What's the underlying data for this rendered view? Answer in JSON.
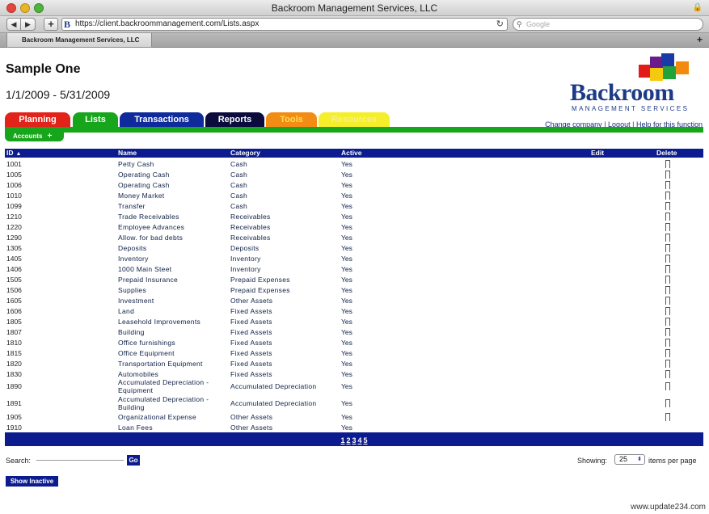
{
  "window": {
    "title": "Backroom Management Services, LLC"
  },
  "browser": {
    "url": "https://client.backroommanagement.com/Lists.aspx",
    "favicon_letter": "B",
    "search_placeholder": "Google",
    "tab_label": "Backroom Management Services, LLC",
    "add_label": "+",
    "new_tab_label": "+",
    "back_label": "◀",
    "forward_label": "▶",
    "reload_label": "↻",
    "lock_label": "🔒",
    "search_glass_label": "⚲"
  },
  "page": {
    "title": "Sample One",
    "date_range": "1/1/2009 - 5/31/2009"
  },
  "logo": {
    "word": "Backroom",
    "subtitle": "MANAGEMENT SERVICES",
    "colors": {
      "red": "#e11b17",
      "orange": "#f28a0d",
      "yellow": "#f5c90e",
      "purple": "#6b1b8a",
      "blue": "#1b3aa6",
      "green": "#22a33a",
      "navy": "#1c3a86"
    }
  },
  "top_links": {
    "change_company": "Change company",
    "logout": "Logout",
    "help": "Help for this function",
    "separator": "|"
  },
  "main_tabs": [
    {
      "label": "Planning",
      "color": "#e2231a"
    },
    {
      "label": "Lists",
      "color": "#16a51b"
    },
    {
      "label": "Transactions",
      "color": "#0e2a9b"
    },
    {
      "label": "Reports",
      "color": "#0b0b3d"
    },
    {
      "label": "Tools",
      "color": "#f28c14"
    },
    {
      "label": "Resources",
      "color": "#f5ee2a"
    }
  ],
  "sub_tab": {
    "label": "Accounts",
    "add": "+"
  },
  "table": {
    "headers": {
      "id": "ID",
      "name": "Name",
      "category": "Category",
      "active": "Active",
      "edit": "Edit",
      "delete": "Delete"
    },
    "sort_indicator": "▲",
    "rows": [
      {
        "id": "1001",
        "name": "Petty Cash",
        "category": "Cash",
        "active": "Yes"
      },
      {
        "id": "1005",
        "name": "Operating Cash",
        "category": "Cash",
        "active": "Yes"
      },
      {
        "id": "1006",
        "name": "Operating Cash",
        "category": "Cash",
        "active": "Yes"
      },
      {
        "id": "1010",
        "name": "Money Market",
        "category": "Cash",
        "active": "Yes"
      },
      {
        "id": "1099",
        "name": "Transfer",
        "category": "Cash",
        "active": "Yes"
      },
      {
        "id": "1210",
        "name": "Trade Receivables",
        "category": "Receivables",
        "active": "Yes"
      },
      {
        "id": "1220",
        "name": "Employee Advances",
        "category": "Receivables",
        "active": "Yes"
      },
      {
        "id": "1290",
        "name": "Allow. for bad debts",
        "category": "Receivables",
        "active": "Yes"
      },
      {
        "id": "1305",
        "name": "Deposits",
        "category": "Deposits",
        "active": "Yes"
      },
      {
        "id": "1405",
        "name": "Inventory",
        "category": "Inventory",
        "active": "Yes"
      },
      {
        "id": "1406",
        "name": "1000 Main Steet",
        "category": "Inventory",
        "active": "Yes"
      },
      {
        "id": "1505",
        "name": "Prepaid Insurance",
        "category": "Prepaid Expenses",
        "active": "Yes"
      },
      {
        "id": "1506",
        "name": "Supplies",
        "category": "Prepaid Expenses",
        "active": "Yes"
      },
      {
        "id": "1605",
        "name": "Investment",
        "category": "Other Assets",
        "active": "Yes"
      },
      {
        "id": "1606",
        "name": "Land",
        "category": "Fixed Assets",
        "active": "Yes"
      },
      {
        "id": "1805",
        "name": "Leasehold Improvements",
        "category": "Fixed Assets",
        "active": "Yes"
      },
      {
        "id": "1807",
        "name": "Building",
        "category": "Fixed Assets",
        "active": "Yes"
      },
      {
        "id": "1810",
        "name": "Office furnishings",
        "category": "Fixed Assets",
        "active": "Yes"
      },
      {
        "id": "1815",
        "name": "Office Equipment",
        "category": "Fixed Assets",
        "active": "Yes"
      },
      {
        "id": "1820",
        "name": "Transportation Equipment",
        "category": "Fixed Assets",
        "active": "Yes"
      },
      {
        "id": "1830",
        "name": "Automobiles",
        "category": "Fixed Assets",
        "active": "Yes"
      },
      {
        "id": "1890",
        "name": "Accumulated Depreciation - Equipment",
        "category": "Accumulated Depreciation",
        "active": "Yes"
      },
      {
        "id": "1891",
        "name": "Accumulated Depreciation - Building",
        "category": "Accumulated Depreciation",
        "active": "Yes"
      },
      {
        "id": "1905",
        "name": "Organizational Expense",
        "category": "Other Assets",
        "active": "Yes"
      },
      {
        "id": "1910",
        "name": "Loan Fees",
        "category": "Other Assets",
        "active": "Yes"
      }
    ]
  },
  "pagination": {
    "pages": [
      "1",
      "2",
      "3",
      "4",
      "5"
    ]
  },
  "search": {
    "label": "Search:",
    "value": "",
    "button": "Go"
  },
  "paging": {
    "showing_label": "Showing:",
    "per_page_value": "25",
    "per_page_suffix": "items per page",
    "spinner_label": "⬍"
  },
  "buttons": {
    "show_inactive": "Show Inactive"
  },
  "watermark": "www.update234.com"
}
